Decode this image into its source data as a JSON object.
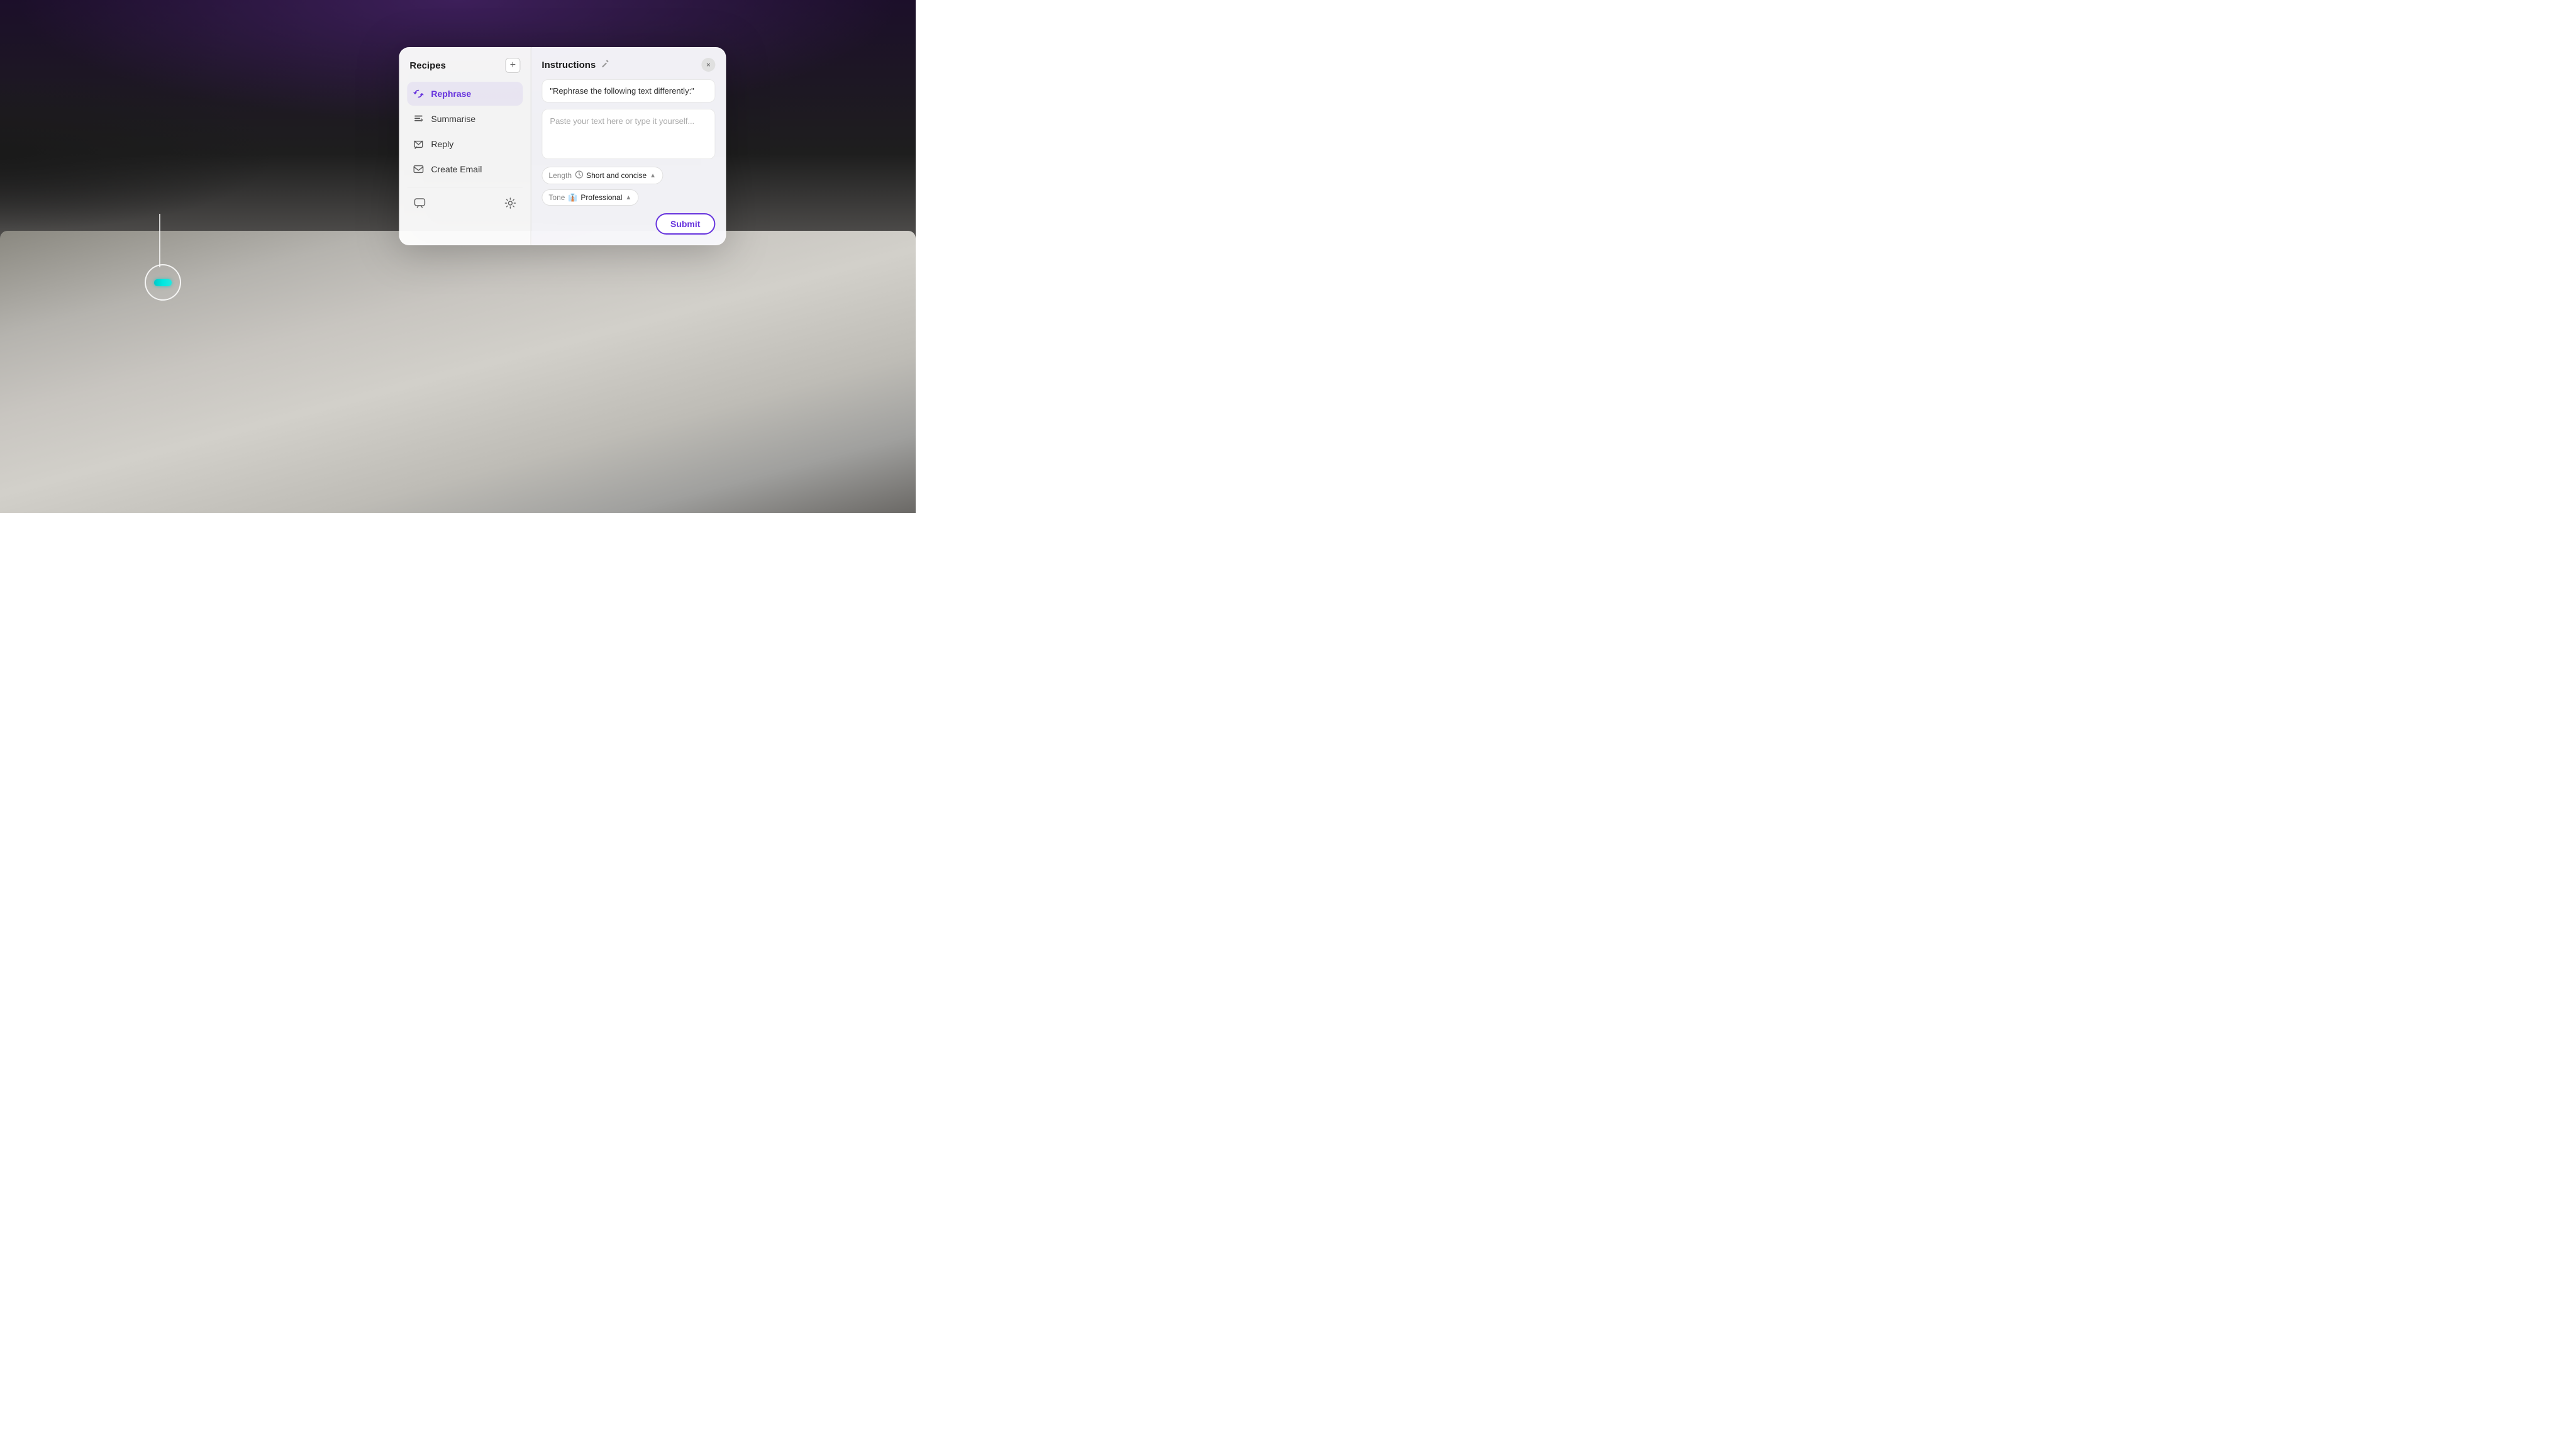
{
  "background": {
    "description": "Dark purple/black background with mouse on gray mousepad"
  },
  "recipes_panel": {
    "title": "Recipes",
    "add_button_label": "+",
    "items": [
      {
        "id": "rephrase",
        "label": "Rephrase",
        "active": true,
        "icon": "rephrase"
      },
      {
        "id": "summarise",
        "label": "Summarise",
        "active": false,
        "icon": "summarise"
      },
      {
        "id": "reply",
        "label": "Reply",
        "active": false,
        "icon": "reply"
      },
      {
        "id": "create-email",
        "label": "Create Email",
        "active": false,
        "icon": "email"
      }
    ],
    "footer_icons": [
      "chat",
      "settings"
    ]
  },
  "instructions_panel": {
    "title": "Instructions",
    "close_label": "×",
    "prompt_text": "\"Rephrase the following text differently:\"",
    "textarea_placeholder": "Paste your text here or type it yourself...",
    "length_label": "Length",
    "length_value": "Short and concise",
    "tone_label": "Tone",
    "tone_value": "Professional",
    "tone_emoji": "👔",
    "submit_label": "Submit"
  }
}
